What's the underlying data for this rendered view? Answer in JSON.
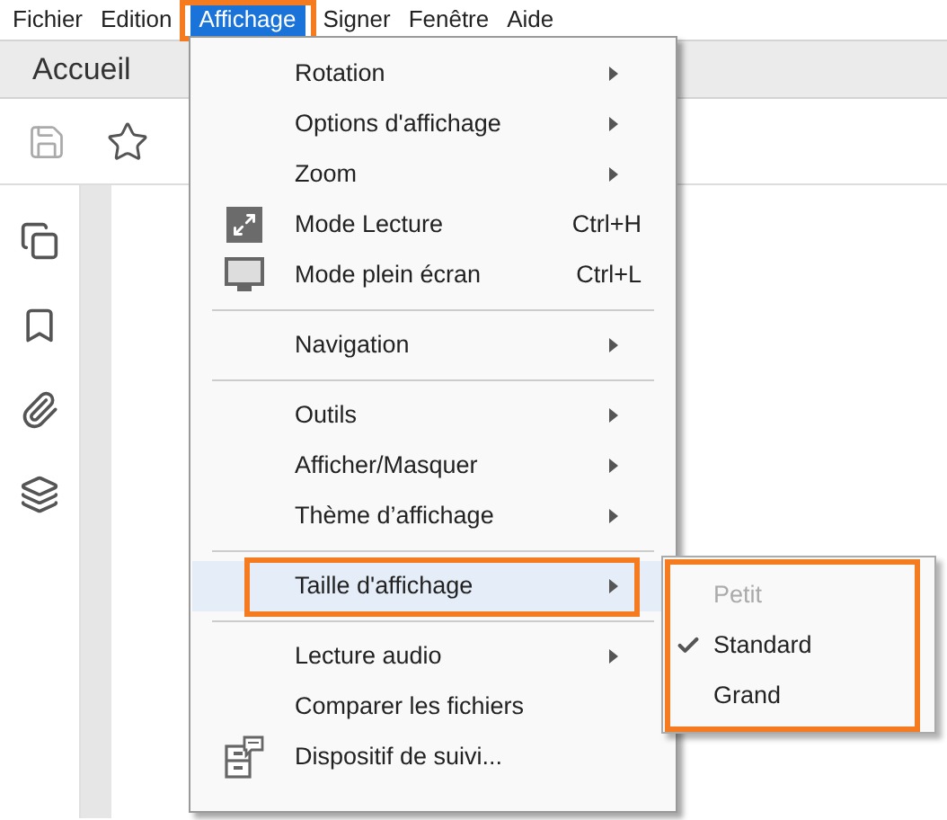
{
  "menubar": [
    {
      "label": "Fichier",
      "selected": false,
      "outlined": false
    },
    {
      "label": "Edition",
      "selected": false,
      "outlined": false
    },
    {
      "label": "Affichage",
      "selected": true,
      "outlined": true
    },
    {
      "label": "Signer",
      "selected": false,
      "outlined": false
    },
    {
      "label": "Fenêtre",
      "selected": false,
      "outlined": false
    },
    {
      "label": "Aide",
      "selected": false,
      "outlined": false
    }
  ],
  "tabs": [
    {
      "label": "Accueil"
    }
  ],
  "menu": {
    "items": [
      {
        "kind": "item",
        "label": "Rotation",
        "submenu": true,
        "selected": false,
        "outlined": false
      },
      {
        "kind": "item",
        "label": "Options d'affichage",
        "submenu": true,
        "selected": false,
        "outlined": false
      },
      {
        "kind": "item",
        "label": "Zoom",
        "submenu": true,
        "selected": false,
        "outlined": false
      },
      {
        "kind": "item",
        "label": "Mode Lecture",
        "shortcut": "Ctrl+H",
        "submenu": false,
        "selected": false,
        "outlined": false
      },
      {
        "kind": "item",
        "label": "Mode plein écran",
        "shortcut": "Ctrl+L",
        "submenu": false,
        "selected": false,
        "outlined": false
      },
      {
        "kind": "separator"
      },
      {
        "kind": "item",
        "label": "Navigation",
        "submenu": true,
        "selected": false,
        "outlined": false
      },
      {
        "kind": "separator"
      },
      {
        "kind": "item",
        "label": "Outils",
        "submenu": true,
        "selected": false,
        "outlined": false
      },
      {
        "kind": "item",
        "label": "Afficher/Masquer",
        "submenu": true,
        "selected": false,
        "outlined": false
      },
      {
        "kind": "item",
        "label": "Thème d’affichage",
        "submenu": true,
        "selected": false,
        "outlined": false
      },
      {
        "kind": "separator"
      },
      {
        "kind": "item",
        "label": "Taille d'affichage",
        "submenu": true,
        "selected": true,
        "outlined": true
      },
      {
        "kind": "separator"
      },
      {
        "kind": "item",
        "label": "Lecture audio",
        "submenu": true,
        "selected": false,
        "outlined": false
      },
      {
        "kind": "item",
        "label": "Comparer les fichiers",
        "submenu": false,
        "selected": false,
        "outlined": false
      },
      {
        "kind": "item",
        "label": "Dispositif de suivi...",
        "submenu": false,
        "selected": false,
        "outlined": false
      }
    ]
  },
  "submenu": {
    "outlined": true,
    "items": [
      {
        "label": "Petit",
        "checked": false,
        "disabled": true
      },
      {
        "label": "Standard",
        "checked": true,
        "disabled": false
      },
      {
        "label": "Grand",
        "checked": false,
        "disabled": false
      }
    ]
  }
}
